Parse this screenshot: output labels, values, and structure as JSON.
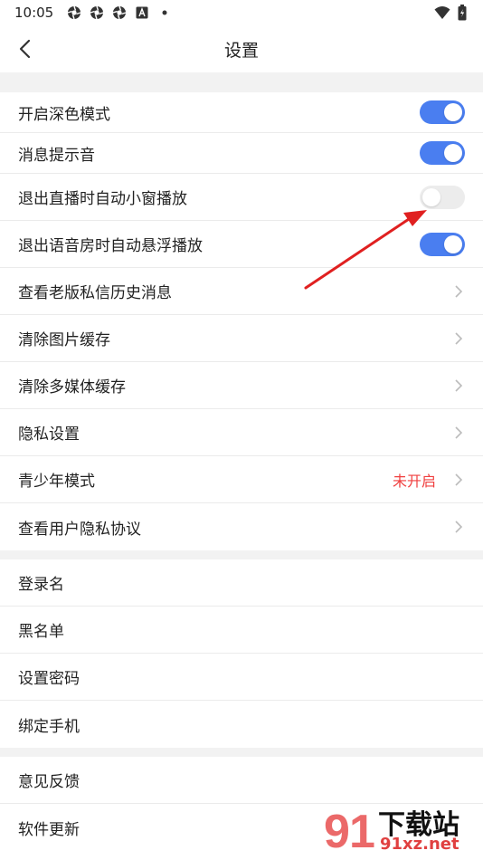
{
  "status_bar": {
    "time": "10:05",
    "icons": [
      "aperture-icon",
      "aperture-icon",
      "aperture-icon",
      "a-box-icon",
      "dot-icon"
    ],
    "right_icons": [
      "wifi-icon",
      "battery-icon"
    ]
  },
  "nav": {
    "title": "设置",
    "back_icon": "chevron-left-icon"
  },
  "section1": [
    {
      "label": "开启深色模式",
      "toggle": "on"
    },
    {
      "label": "消息提示音",
      "toggle": "on"
    },
    {
      "label": "退出直播时自动小窗播放",
      "toggle": "off"
    },
    {
      "label": "退出语音房时自动悬浮播放",
      "toggle": "on"
    },
    {
      "label": "查看老版私信历史消息"
    },
    {
      "label": "清除图片缓存"
    },
    {
      "label": "清除多媒体缓存"
    },
    {
      "label": "隐私设置"
    },
    {
      "label": "青少年模式",
      "value": "未开启"
    },
    {
      "label": "查看用户隐私协议"
    }
  ],
  "section2": [
    {
      "label": "登录名"
    },
    {
      "label": "黑名单"
    },
    {
      "label": "设置密码"
    },
    {
      "label": "绑定手机"
    }
  ],
  "section3": [
    {
      "label": "意见反馈"
    },
    {
      "label": "软件更新"
    }
  ],
  "colors": {
    "toggle_on": "#4a7ef0",
    "toggle_off": "#ececec",
    "value_red": "#f04040",
    "annotation_arrow": "#e02020",
    "section_gap": "#f2f2f2"
  },
  "watermark": {
    "brand": "下载站",
    "url": "91xz.net"
  }
}
